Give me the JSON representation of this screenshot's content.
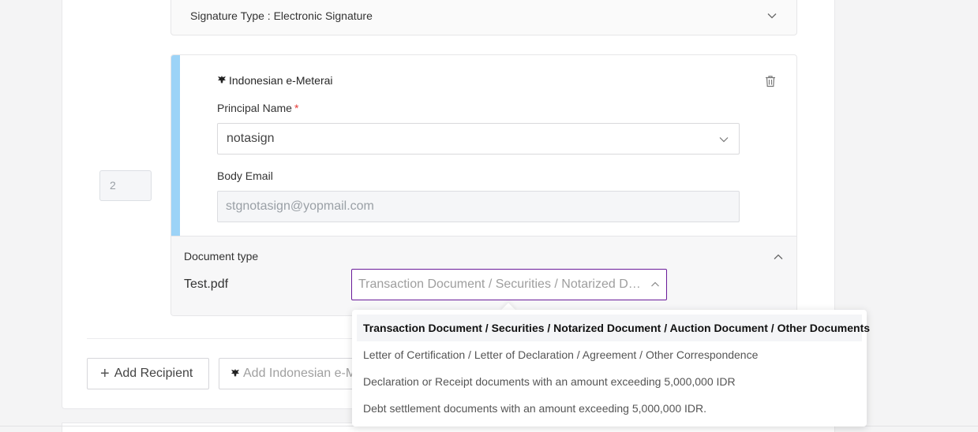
{
  "signature_section": {
    "type_label": "Signature Type : Electronic Signature"
  },
  "recipient": {
    "order": "2",
    "title": "Indonesian e-Meterai",
    "principal_label": "Principal Name",
    "required_mark": "*",
    "principal_value": "notasign",
    "email_label": "Body Email",
    "email_value": "stgnotasign@yopmail.com",
    "document_type_label": "Document type",
    "file_name": "Test.pdf",
    "document_type_selected": "Transaction Document / Securities / Notarized Document / Auction Document / Other Documents"
  },
  "document_type_options": [
    "Transaction Document / Securities / Notarized Document / Auction Document / Other Documents",
    "Letter of Certification / Letter of Declaration / Agreement / Other Correspondence",
    "Declaration or Receipt documents with an amount exceeding 5,000,000 IDR",
    "Debt settlement documents with an amount exceeding 5,000,000 IDR."
  ],
  "actions": {
    "add_recipient": "Add Recipient",
    "add_meterai": "Add Indonesian e-Meterai"
  },
  "icons": {
    "emblem": "garuda-emblem-icon",
    "delete": "trash-icon",
    "expand": "chevron-down-icon",
    "collapse": "chevron-up-icon",
    "add": "plus-icon"
  },
  "colors": {
    "accent_bar": "#9cd3f7",
    "focus_border": "#6a1b9a",
    "required": "#e53935"
  }
}
